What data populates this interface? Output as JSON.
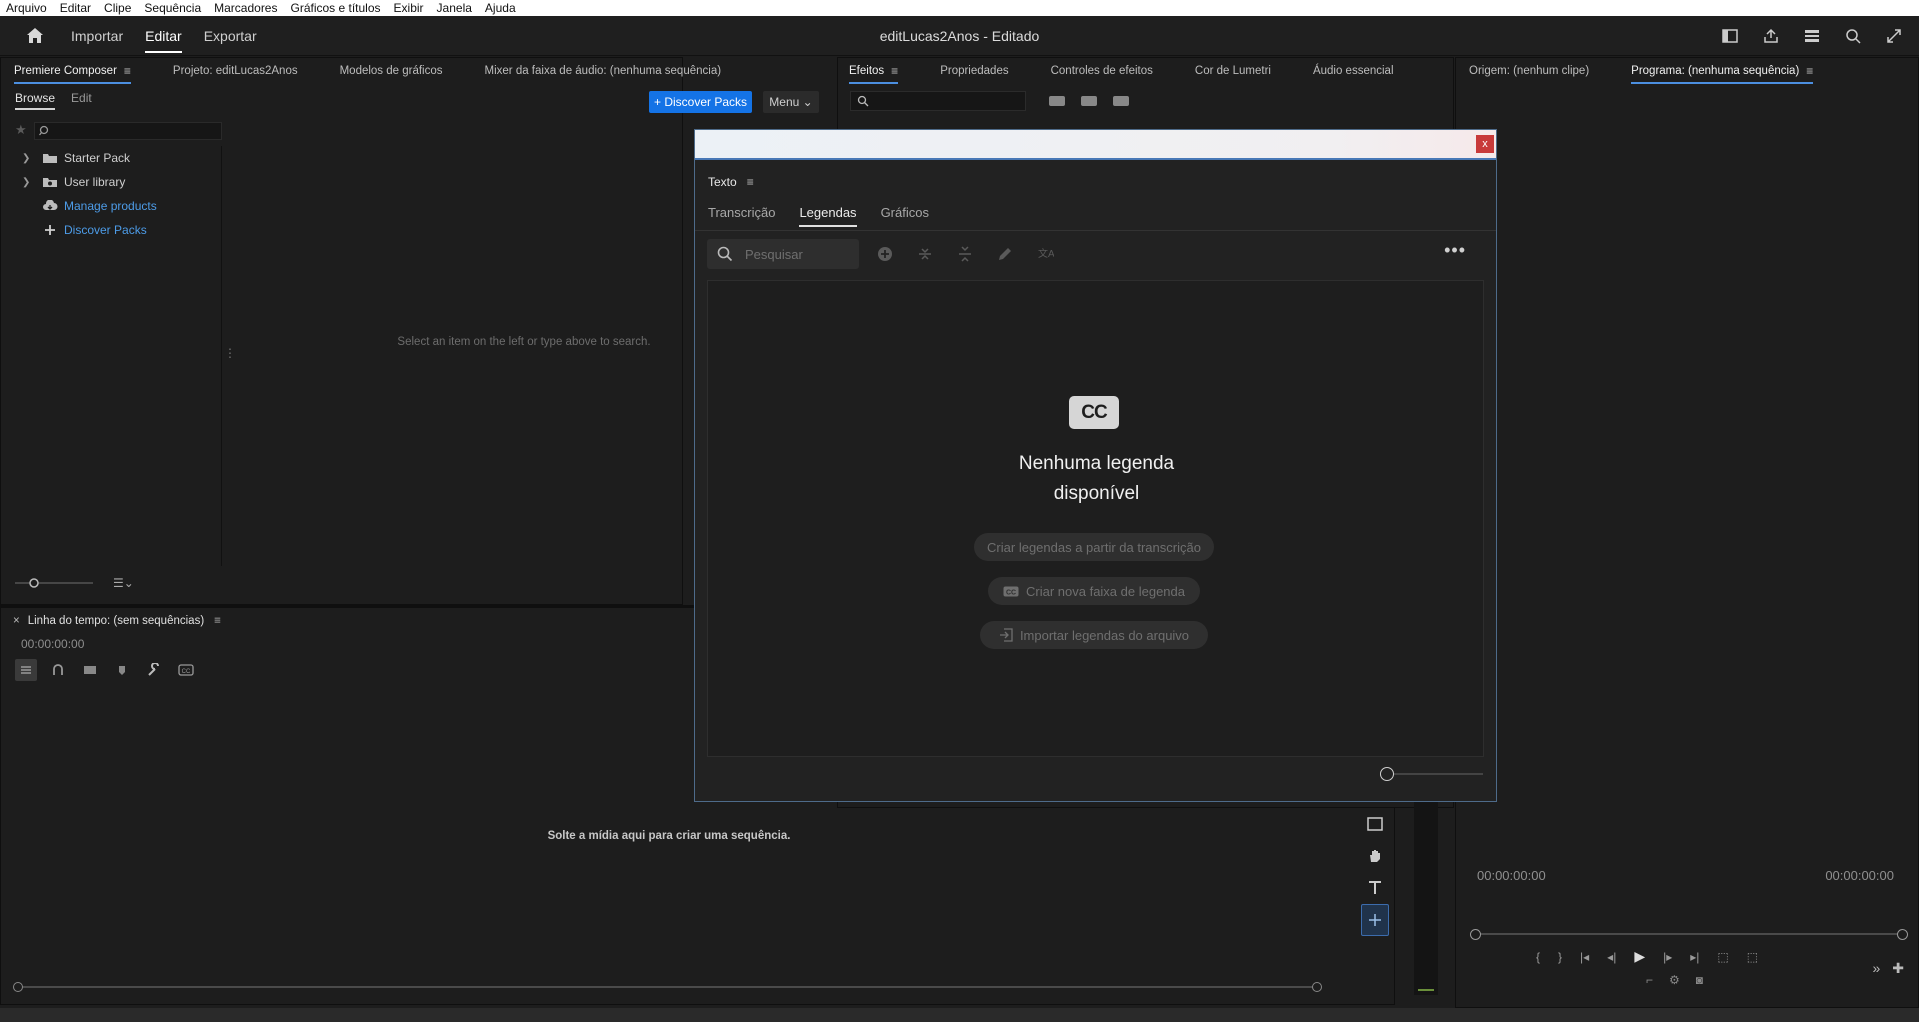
{
  "menubar": [
    "Arquivo",
    "Editar",
    "Clipe",
    "Sequência",
    "Marcadores",
    "Gráficos e títulos",
    "Exibir",
    "Janela",
    "Ajuda"
  ],
  "header": {
    "modes": [
      "Importar",
      "Editar",
      "Exportar"
    ],
    "active_mode": "Editar",
    "title": "editLucas2Anos - Editado",
    "icons": [
      "workspace-icon",
      "share-icon",
      "panels-icon",
      "search-help-icon",
      "fullscreen-icon"
    ]
  },
  "left_panel": {
    "tabs": [
      "Premiere Composer",
      "Projeto: editLucas2Anos",
      "Modelos de gráficos",
      "Mixer da faixa de áudio: (nenhuma sequência)"
    ],
    "subtabs": [
      "Browse",
      "Edit"
    ],
    "discover_label": "+ Discover Packs",
    "menu_label": "Menu",
    "tree": [
      {
        "label": "Starter Pack",
        "icon": "folder-icon",
        "link": false
      },
      {
        "label": "User library",
        "icon": "library-folder-icon",
        "link": false
      },
      {
        "label": "Manage products",
        "icon": "cloud-download-icon",
        "link": true
      },
      {
        "label": "Discover Packs",
        "icon": "plus-icon",
        "link": true
      }
    ],
    "empty_message": "Select an item on the left or type above to search."
  },
  "timeline": {
    "title": "Linha do tempo: (sem sequências)",
    "timecode": "00:00:00:00",
    "drop_message": "Solte a mídia aqui para criar uma sequência."
  },
  "effects_panel": {
    "tabs": [
      "Efeitos",
      "Propriedades",
      "Controles de efeitos",
      "Cor de Lumetri",
      "Áudio essencial"
    ]
  },
  "program_panel": {
    "tabs": [
      "Origem: (nenhum clipe)",
      "Programa: (nenhuma sequência)"
    ],
    "timecode_left": "00:00:00:00",
    "timecode_right": "00:00:00:00"
  },
  "dialog": {
    "close_label": "x",
    "panel_title": "Texto",
    "tabs": [
      "Transcrição",
      "Legendas",
      "Gráficos"
    ],
    "active_tab": "Legendas",
    "search_placeholder": "Pesquisar",
    "cc_label": "CC",
    "empty_title_line1": "Nenhuma legenda",
    "empty_title_line2": "disponível",
    "buttons": {
      "from_transcript": "Criar legendas a partir da transcrição",
      "new_track": "Criar nova faixa de legenda",
      "import_file": "Importar legendas do arquivo"
    },
    "more_label": "•••"
  }
}
